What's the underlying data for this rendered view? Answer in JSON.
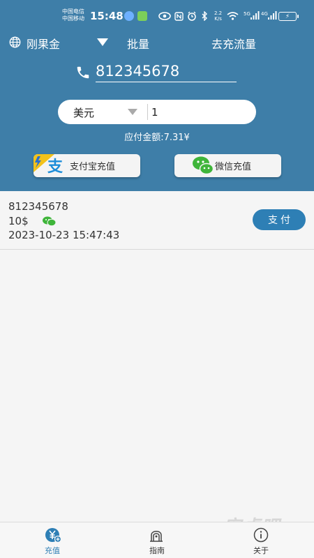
{
  "status_bar": {
    "carrier1": "中国电信",
    "carrier2": "中国移动",
    "time": "15:48",
    "speed_value": "2.2",
    "speed_unit": "K/s",
    "net1": "5G",
    "net2": "4G"
  },
  "top": {
    "user_label": "刚果金",
    "batch_label": "批量",
    "flow_label": "去充流量"
  },
  "phone": {
    "value": "812345678"
  },
  "currency": {
    "selected": "美元",
    "amount": "1"
  },
  "payable_text": "应付金额:7.31¥",
  "buttons": {
    "alipay_label": "支付宝充值",
    "wechat_label": "微信充值"
  },
  "records": [
    {
      "phone": "812345678",
      "amount": "10$",
      "time": "2023-10-23 15:47:43",
      "pay_label": "支付"
    }
  ],
  "nav": {
    "charge_label": "充值",
    "guide_label": "指南",
    "about_label": "关于"
  },
  "watermark": "安卓吧",
  "colors": {
    "header": "#3e7ea8",
    "accent": "#2e7fb5",
    "wechat": "#3fb53a"
  }
}
